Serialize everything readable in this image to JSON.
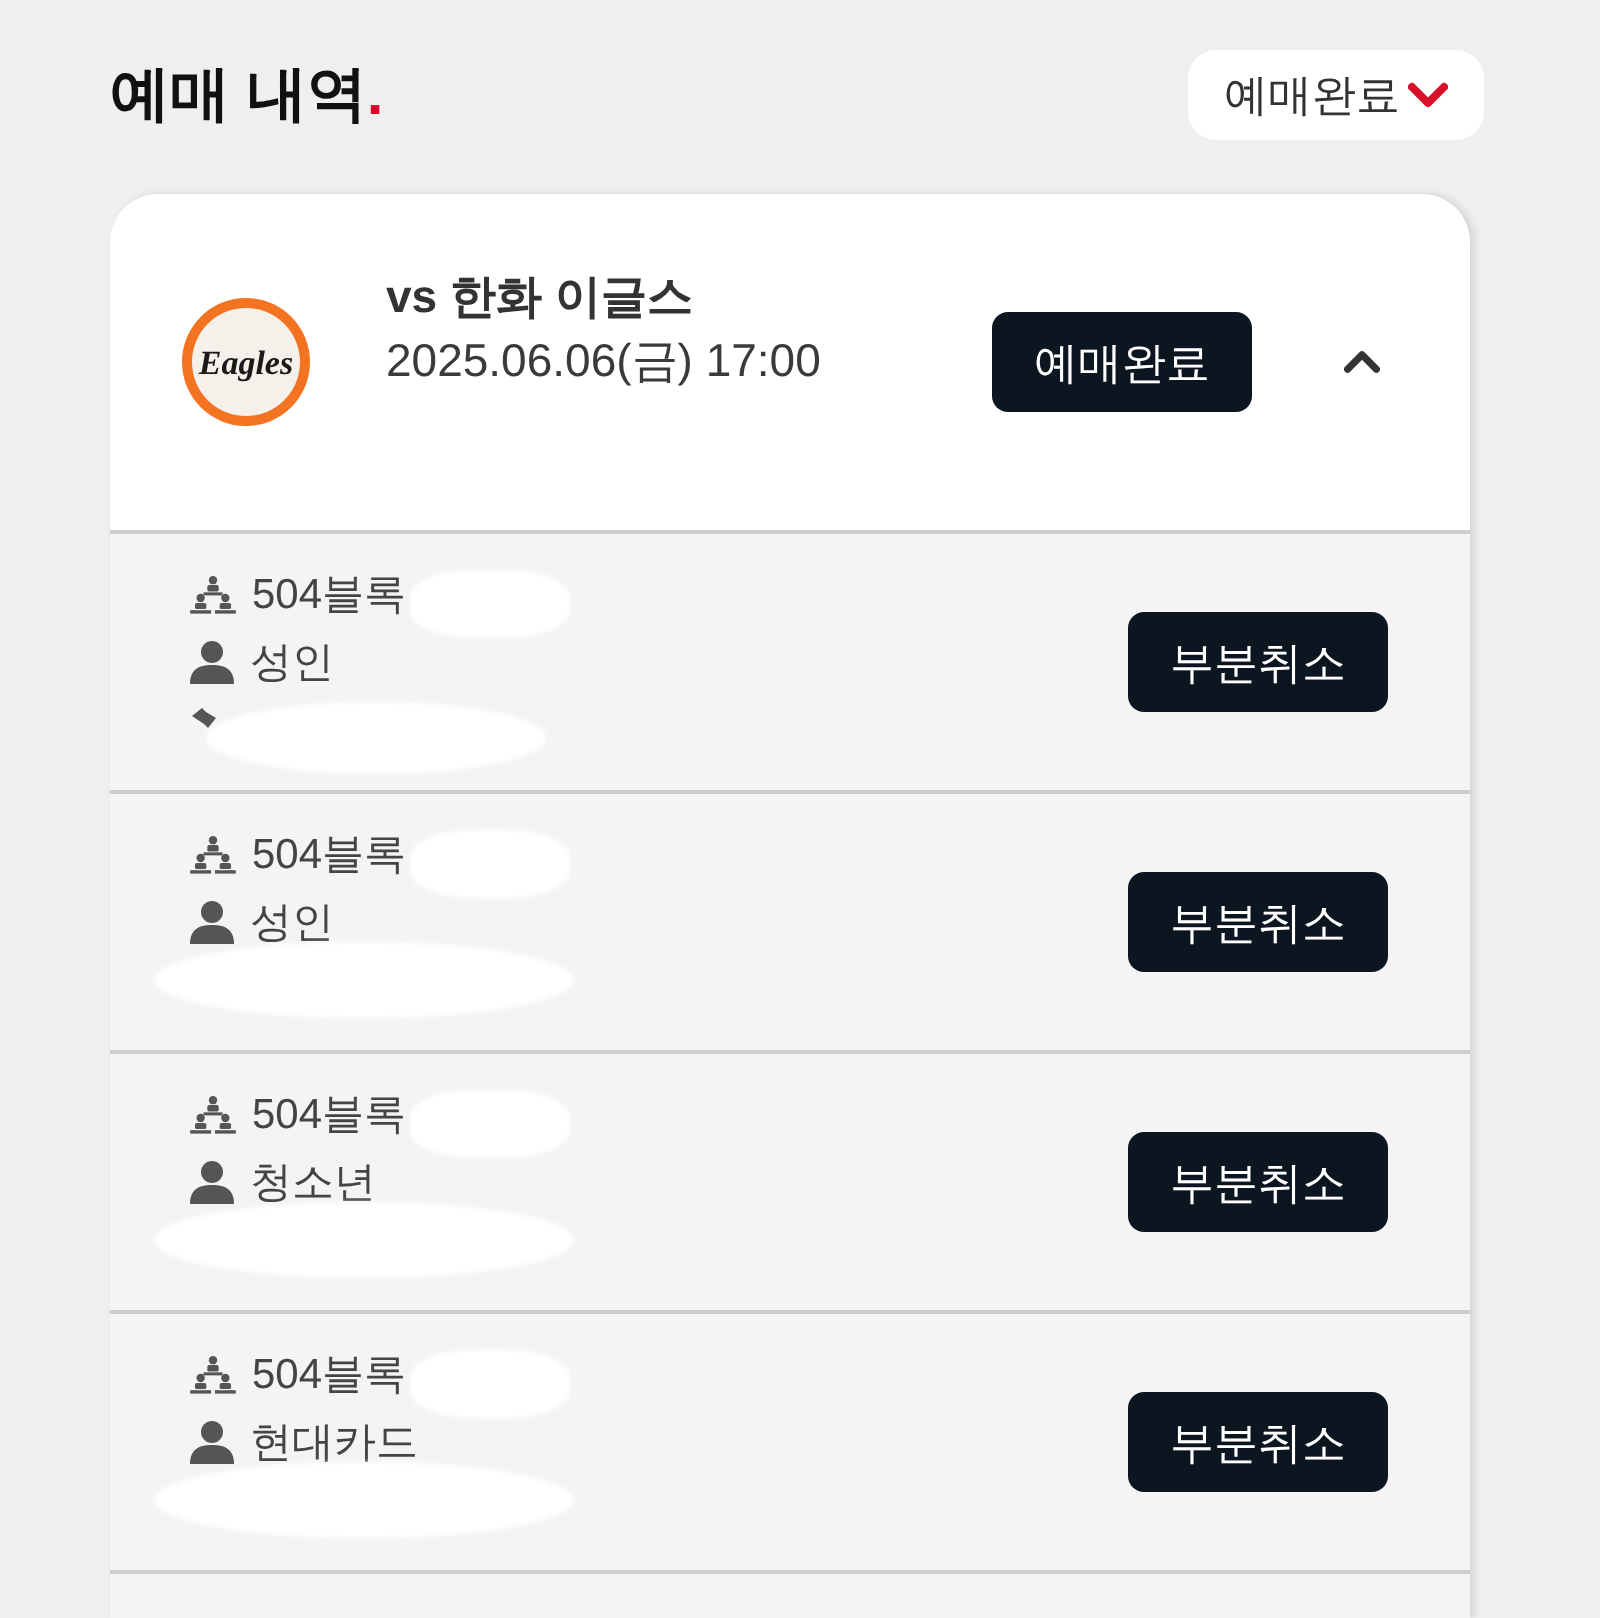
{
  "page": {
    "title": "예매 내역",
    "title_mark": "."
  },
  "filter": {
    "label": "예매완료",
    "expanded": false
  },
  "booking": {
    "logo": {
      "wordmark": "Eagles"
    },
    "opponent": "vs 한화 이글스",
    "datetime": "2025.06.06(금) 17:00",
    "status": "예매완료",
    "expanded": true,
    "tickets": [
      {
        "seat": "504블록",
        "holder": "성인",
        "ticket_icon": true,
        "action": "부분취소"
      },
      {
        "seat": "504블록",
        "holder": "성인",
        "ticket_icon": false,
        "action": "부분취소"
      },
      {
        "seat": "504블록",
        "holder": "청소년",
        "ticket_icon": false,
        "action": "부분취소"
      },
      {
        "seat": "504블록",
        "holder": "현대카드",
        "ticket_icon": false,
        "action": "부분취소"
      }
    ]
  }
}
